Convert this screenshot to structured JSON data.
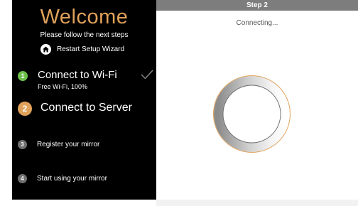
{
  "sidebar": {
    "welcome_title": "Welcome",
    "instructions": "Please follow the next steps",
    "restart_label": "Restart Setup Wizard",
    "steps": [
      {
        "number": "1",
        "title": "Connect to Wi-Fi",
        "subtitle": "Free Wi-Fi, 100%",
        "status": "complete",
        "color": "#6cc04a"
      },
      {
        "number": "2",
        "title": "Connect to Server",
        "status": "active",
        "color": "#e0a15a"
      },
      {
        "number": "3",
        "title": "Register your mirror",
        "status": "pending",
        "color": "#707070"
      },
      {
        "number": "4",
        "title": "Start using your mirror",
        "status": "pending",
        "color": "#707070"
      }
    ]
  },
  "main": {
    "step_header": "Step 2",
    "status_text": "Connecting..."
  },
  "icons": {
    "restart": "home-icon",
    "step1_done": "checkmark-icon",
    "progress": "loading-spinner"
  },
  "colors": {
    "accent": "#e0a15a",
    "success": "#6cc04a",
    "inactive": "#707070",
    "header_bg": "#7d7d7d"
  }
}
